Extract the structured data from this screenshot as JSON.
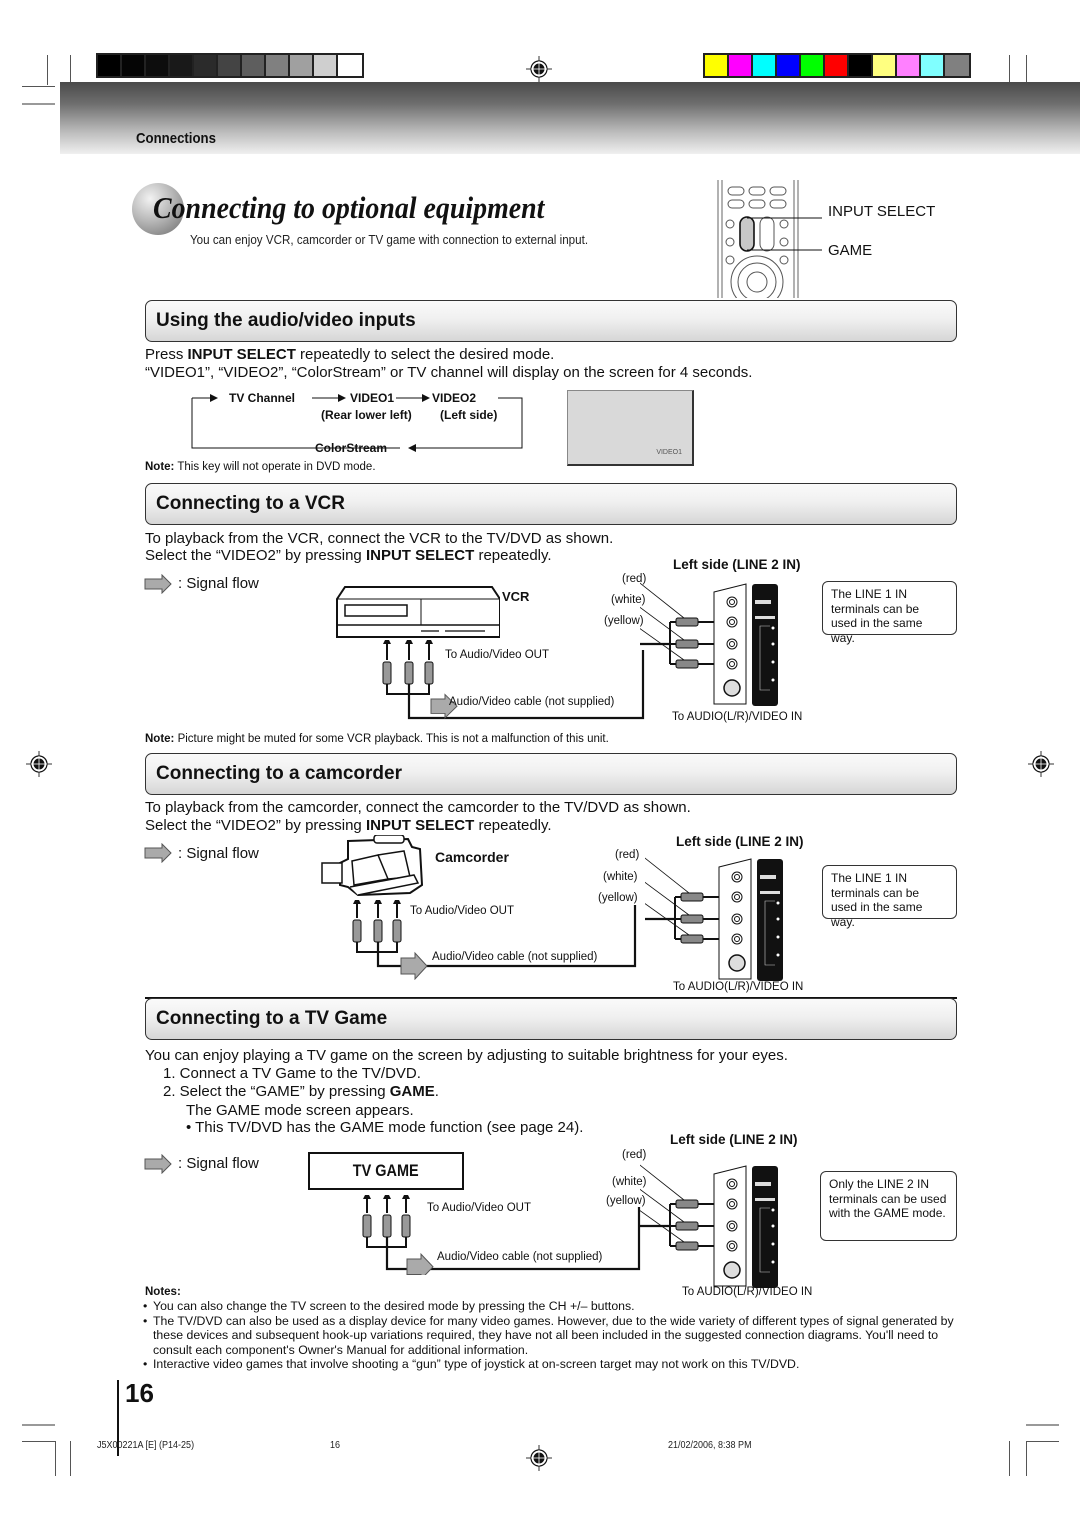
{
  "header": {
    "gray_swatches": [
      "#000000",
      "#050505",
      "#0d0d0d",
      "#191919",
      "#2b2b2b",
      "#444444",
      "#5e5e5e",
      "#808080",
      "#a0a0a0",
      "#cfcfcf",
      "#ffffff"
    ],
    "color_swatches": [
      "#ffff00",
      "#ff00ff",
      "#00ffff",
      "#0000ff",
      "#00ff00",
      "#ff0000",
      "#000000",
      "#ffff80",
      "#ff80ff",
      "#80ffff",
      "#808080"
    ],
    "section_label": "Connections"
  },
  "title": {
    "heading": "Connecting to optional equipment",
    "subtitle": "You can enjoy VCR, camcorder or TV game with connection to external input.",
    "remote_labels": {
      "input_select": "INPUT SELECT",
      "game": "GAME"
    }
  },
  "av_inputs": {
    "heading": "Using the audio/video inputs",
    "line1_pre": "Press ",
    "line1_bold": "INPUT SELECT",
    "line1_post": " repeatedly to select the desired mode.",
    "line2": "“VIDEO1”, “VIDEO2”, “ColorStream” or TV channel will display on the screen for 4 seconds.",
    "cycle": {
      "tv_channel": "TV Channel",
      "video1": "VIDEO1",
      "video2": "VIDEO2",
      "video1_sub": "(Rear lower left)",
      "video2_sub": "(Left side)",
      "colorstream": "ColorStream"
    },
    "screen_label": "VIDEO1",
    "note_bold": "Note:",
    "note_text": " This key will not operate in DVD mode."
  },
  "vcr": {
    "heading": "Connecting to a VCR",
    "line1": "To playback from the VCR, connect the VCR to the TV/DVD as shown.",
    "line2_pre": "Select the “VIDEO2” by pressing ",
    "line2_bold": "INPUT SELECT",
    "line2_post": " repeatedly.",
    "signal_flow": ": Signal flow",
    "device_label": "VCR",
    "out_label": "To Audio/Video OUT",
    "cable_label": "Audio/Video cable  (not supplied)",
    "panel_title": "Left side (LINE 2 IN)",
    "wires": [
      "(red)",
      "(white)",
      "(yellow)"
    ],
    "in_label": "To AUDIO(L/R)/VIDEO IN",
    "side_note": "The LINE 1 IN terminals can be used in the same way.",
    "note_bold": "Note:",
    "note_text": " Picture might be muted for some VCR playback. This is not a malfunction of this unit."
  },
  "camcorder": {
    "heading": "Connecting to a camcorder",
    "line1": "To playback from the camcorder, connect the camcorder to the TV/DVD as shown.",
    "line2_pre": "Select the “VIDEO2” by pressing ",
    "line2_bold": "INPUT SELECT",
    "line2_post": " repeatedly.",
    "signal_flow": ": Signal flow",
    "device_label": "Camcorder",
    "out_label": "To Audio/Video OUT",
    "cable_label": "Audio/Video cable (not supplied)",
    "panel_title": "Left side (LINE 2 IN)",
    "wires": [
      "(red)",
      "(white)",
      "(yellow)"
    ],
    "in_label": "To AUDIO(L/R)/VIDEO IN",
    "side_note": "The LINE 1 IN terminals can be used in the same way."
  },
  "tvgame": {
    "heading": "Connecting to a TV Game",
    "intro": "You can enjoy playing a TV game on the screen by adjusting to suitable brightness for your eyes.",
    "step1": "1.  Connect a TV Game to the TV/DVD.",
    "step2_pre": "2.  Select the “GAME” by pressing ",
    "step2_bold": "GAME",
    "step2_post": ".",
    "step2_sub": "The GAME mode screen appears.",
    "bullet": "•  This TV/DVD has the GAME mode function (see page 24).",
    "signal_flow": ": Signal flow",
    "device_label": "TV GAME",
    "out_label": "To Audio/Video OUT",
    "cable_label": "Audio/Video cable (not supplied)",
    "panel_title": "Left side (LINE 2 IN)",
    "wires": [
      "(red)",
      "(white)",
      "(yellow)"
    ],
    "in_label": "To AUDIO(L/R)/VIDEO IN",
    "side_note": "Only the LINE 2 IN terminals can be used with the GAME mode.",
    "notes_title": "Notes:",
    "notes": [
      "You can also change the TV screen to the desired mode by pressing the CH +/– buttons.",
      "The TV/DVD can also be used as a display device for many video games. However, due to the wide variety of different types of signal generated by these devices and subsequent hook-up variations required, they have not all been included in the suggested connection diagrams. You'll need to consult each component's Owner's Manual for additional information.",
      "Interactive video games that involve shooting a “gun” type of joystick at on-screen target may not work on this TV/DVD."
    ]
  },
  "footer": {
    "page_number": "16",
    "doc_code": "J5X00221A [E] (P14-25)",
    "sheet_number": "16",
    "timestamp": "21/02/2006, 8:38 PM"
  }
}
